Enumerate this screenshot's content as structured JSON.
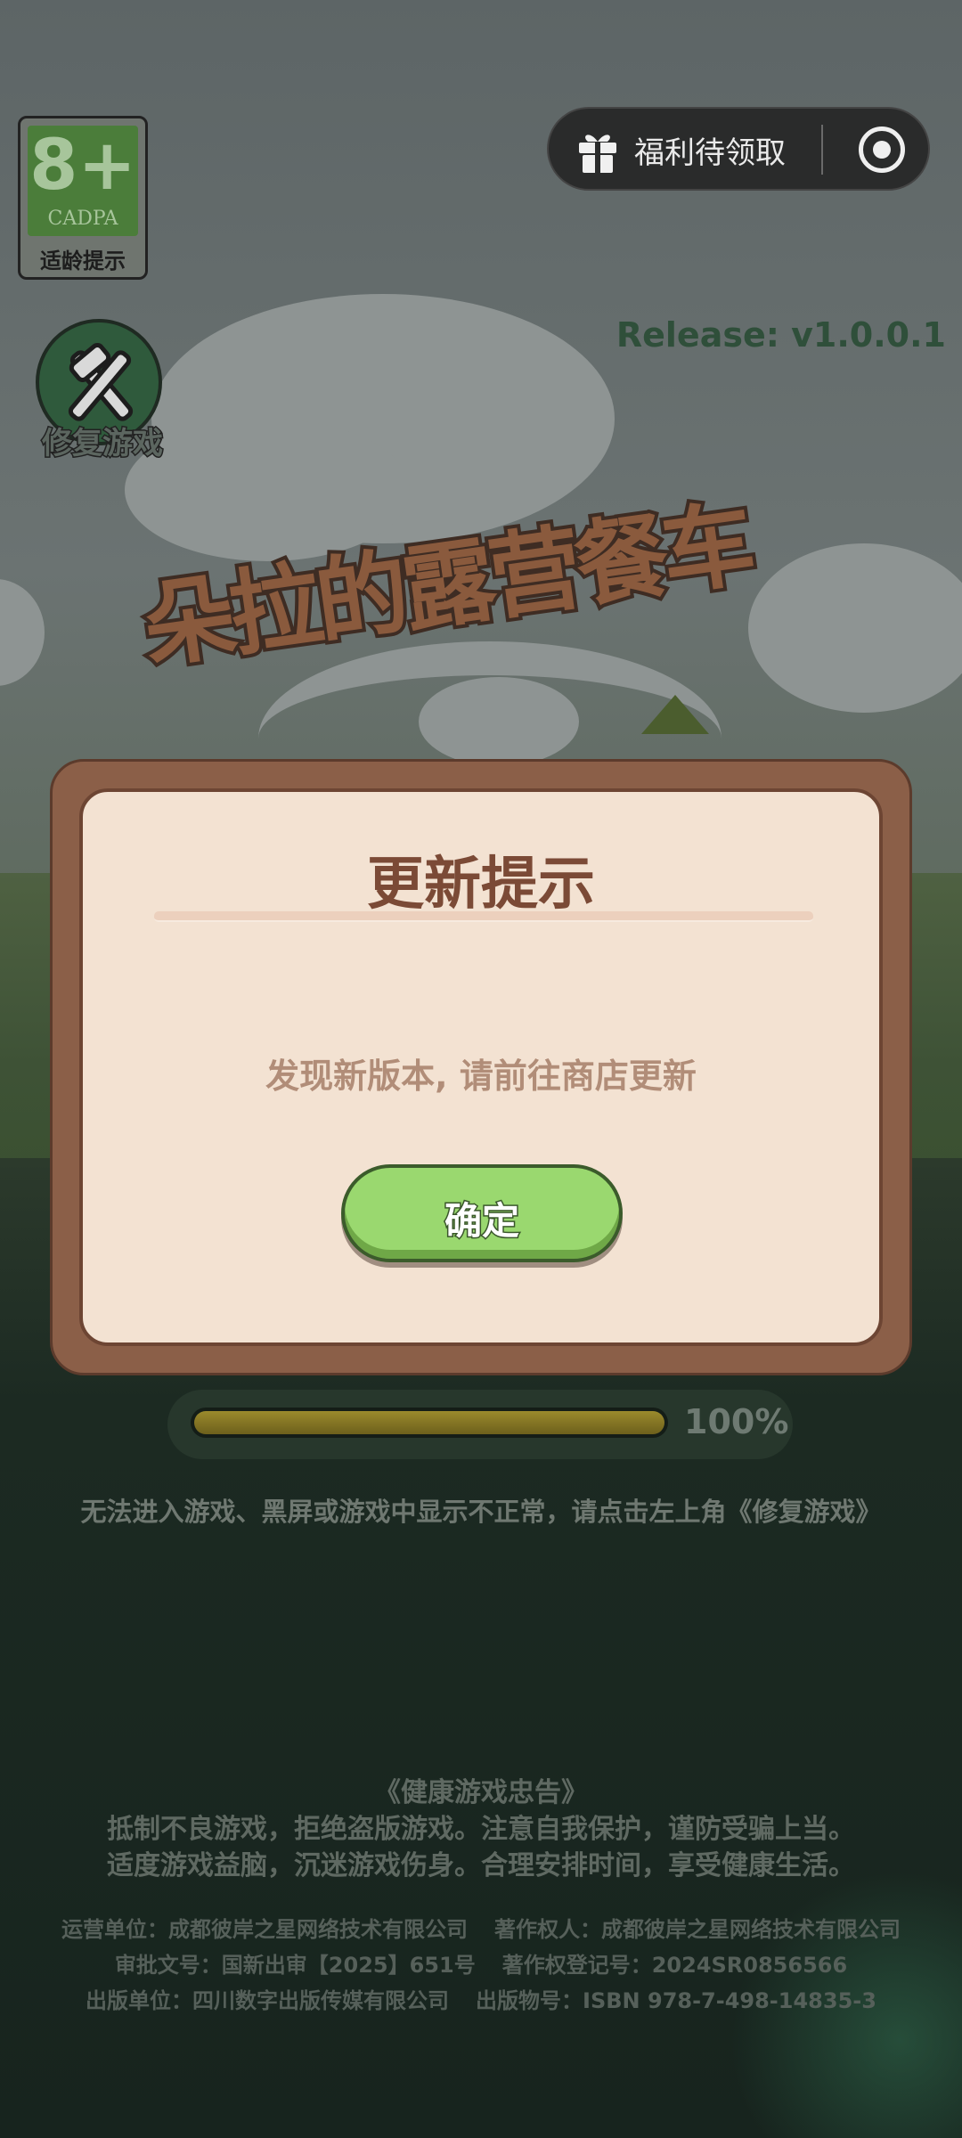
{
  "age_rating": {
    "number": "8+",
    "org": "CADPA",
    "label": "适龄提示"
  },
  "repair": {
    "label": "修复游戏",
    "icon": "wrench-hammer-icon"
  },
  "capsule": {
    "welfare_label": "福利待领取",
    "gift_icon": "gift-icon",
    "record_icon": "record-icon"
  },
  "release": "Release: v1.0.0.1",
  "logo_text": "朵拉的露营餐车",
  "modal": {
    "title": "更新提示",
    "message": "发现新版本, 请前往商店更新",
    "confirm_label": "确定"
  },
  "progress": {
    "percent": 100,
    "label": "100%"
  },
  "hint": "无法进入游戏、黑屏或游戏中显示不正常，请点击左上角《修复游戏》",
  "health_advice": {
    "title": "《健康游戏忠告》",
    "line1": "抵制不良游戏，拒绝盗版游戏。注意自我保护，谨防受骗上当。",
    "line2": "适度游戏益脑，沉迷游戏伤身。合理安排时间，享受健康生活。"
  },
  "info": {
    "operator": "运营单位：成都彼岸之星网络技术有限公司",
    "copyright_owner": "著作权人：成都彼岸之星网络技术有限公司",
    "approval": "审批文号：国新出审【2025】651号",
    "copyright_reg": "著作权登记号：2024SR0856566",
    "publisher": "出版单位：四川数字出版传媒有限公司",
    "isbn": "出版物号：ISBN 978-7-498-14835-3"
  },
  "colors": {
    "accent_green": "#9ad86f",
    "modal_brown": "#8b5f48",
    "title_brown": "#7b4a36"
  }
}
